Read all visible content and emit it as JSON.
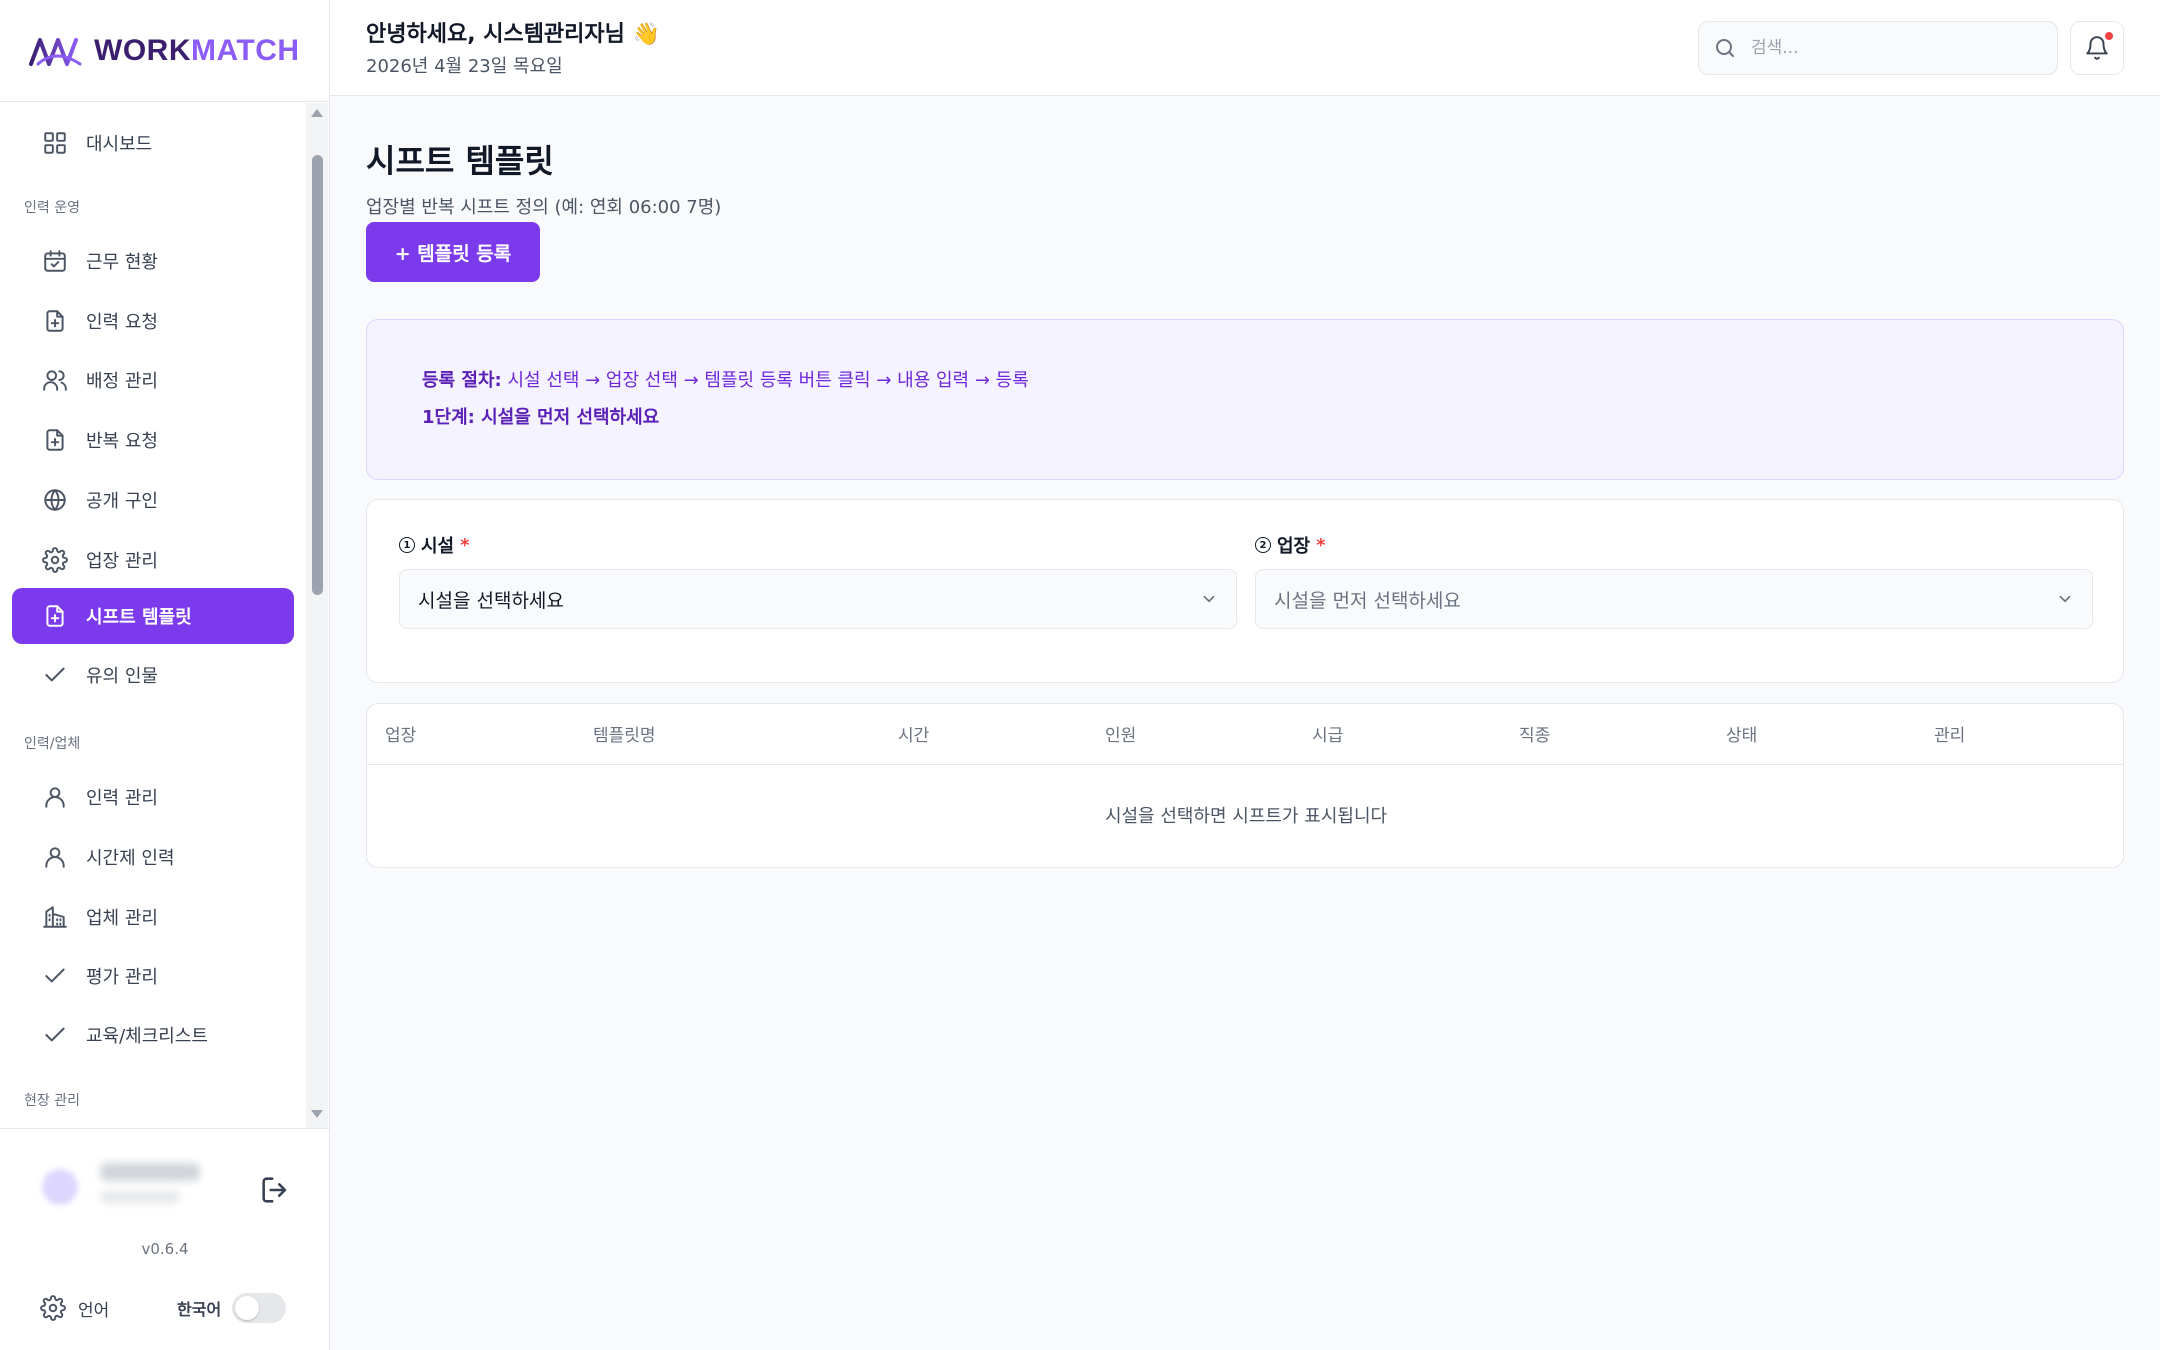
{
  "brand": {
    "name_part1": "WORK",
    "name_part2": "MATCH",
    "colors": {
      "primary": "#7c3aed",
      "dark": "#3b1e6e"
    }
  },
  "header": {
    "greeting": "안녕하세요, 시스템관리자님 👋",
    "date": "2026년 4월 23일 목요일",
    "search_placeholder": "검색..."
  },
  "sidebar": {
    "dashboard": "대시보드",
    "sections": {
      "ops": "인력 운영",
      "workforce": "인력/업체",
      "site": "현장 관리"
    },
    "ops_items": [
      {
        "label": "근무 현황",
        "icon": "calendar-check-icon"
      },
      {
        "label": "인력 요청",
        "icon": "file-plus-icon"
      },
      {
        "label": "배정 관리",
        "icon": "users-icon"
      },
      {
        "label": "반복 요청",
        "icon": "file-plus-icon"
      },
      {
        "label": "공개 구인",
        "icon": "globe-icon"
      },
      {
        "label": "업장 관리",
        "icon": "gear-icon"
      },
      {
        "label": "시프트 템플릿",
        "icon": "file-plus-icon",
        "active": true
      },
      {
        "label": "유의 인물",
        "icon": "check-icon"
      }
    ],
    "workforce_items": [
      {
        "label": "인력 관리",
        "icon": "user-icon"
      },
      {
        "label": "시간제 인력",
        "icon": "user-icon"
      },
      {
        "label": "업체 관리",
        "icon": "building-icon"
      },
      {
        "label": "평가 관리",
        "icon": "check-icon"
      },
      {
        "label": "교육/체크리스트",
        "icon": "check-icon"
      }
    ],
    "footer": {
      "version": "v0.6.4",
      "language_label": "언어",
      "language_value": "한국어"
    }
  },
  "main": {
    "title": "시프트 템플릿",
    "description": "업장별 반복 시프트 정의 (예: 연회 06:00 7명)",
    "add_button": "+ 템플릿 등록",
    "info": {
      "procedure_label": "등록 절차:",
      "procedure_text": " 시설 선택 → 업장 선택 → 템플릿 등록 버튼 클릭 → 내용 입력 → 등록",
      "step_hint": "1단계: 시설을 먼저 선택하세요"
    },
    "facility": {
      "num": "1",
      "label": "시설",
      "required": "*",
      "value": "시설을 선택하세요"
    },
    "venue": {
      "num": "2",
      "label": "업장",
      "required": "*",
      "value": "시설을 먼저 선택하세요"
    },
    "table": {
      "columns": [
        "업장",
        "템플릿명",
        "시간",
        "인원",
        "시급",
        "직종",
        "상태",
        "관리"
      ],
      "empty_message": "시설을 선택하면 시프트가 표시됩니다"
    }
  }
}
